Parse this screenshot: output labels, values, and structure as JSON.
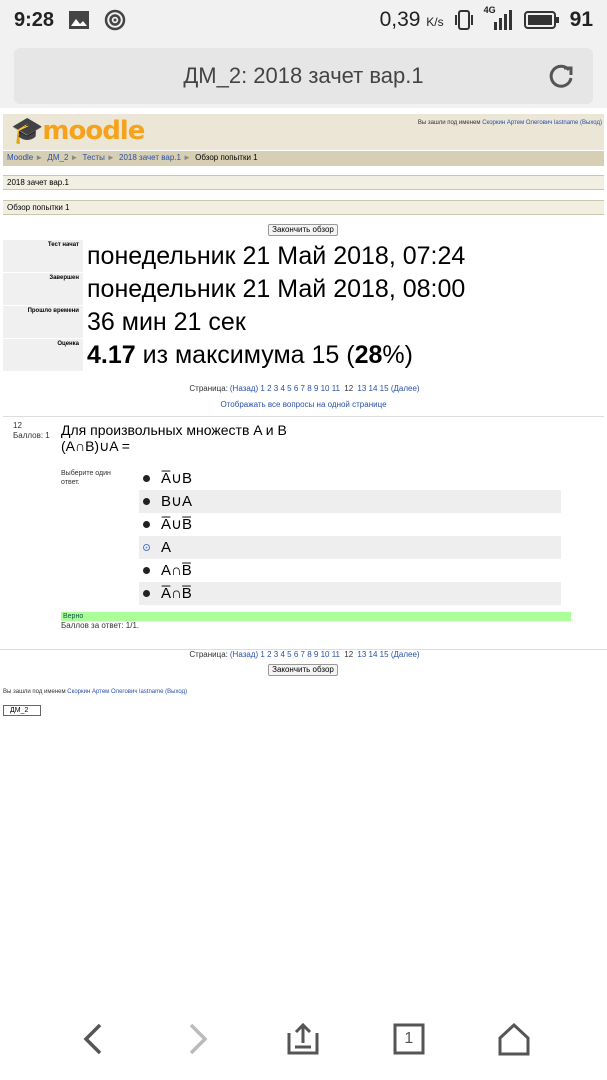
{
  "status": {
    "time": "9:28",
    "speed": "0,39",
    "speed_unit": "K/s",
    "network": "4G",
    "battery": "91"
  },
  "browser": {
    "title": "ДМ_2: 2018 зачет вар.1",
    "tabs_count": "1"
  },
  "header": {
    "logo": "moodle",
    "login_prefix": "Вы зашли под именем",
    "user": "Скоркин Артем Олегович lastname",
    "logout": "(Выход)"
  },
  "breadcrumb": [
    "Moodle",
    "ДМ_2",
    "Тесты",
    "2018 зачет вар.1",
    "Обзор попытки 1"
  ],
  "quiz_title": "2018 зачет вар.1",
  "review_title": "Обзор попытки 1",
  "finish_button": "Закончить обзор",
  "summary": [
    {
      "label": "Тест начат",
      "value": "понедельник 21 Май 2018, 07:24"
    },
    {
      "label": "Завершен",
      "value": "понедельник 21 Май 2018, 08:00"
    },
    {
      "label": "Прошло времени",
      "value": "36 мин 21 сек"
    },
    {
      "label": "Оценка",
      "value_score": "4.17",
      "value_mid": " из максимума 15 (",
      "value_pct": "28",
      "value_end": "%)"
    }
  ],
  "pager": {
    "label": "Страница:",
    "prev": "(Назад)",
    "pages": [
      "1",
      "2",
      "3",
      "4",
      "5",
      "6",
      "7",
      "8",
      "9",
      "10",
      "11",
      "12",
      "13",
      "14",
      "15"
    ],
    "current": "12",
    "next": "(Далее)",
    "show_all": "Отображать все вопросы на одной странице"
  },
  "question": {
    "number": "12",
    "points": "Баллов: 1",
    "text_line1": "Для произвольных множеств A и B",
    "text_line2": "(A∩B)∪A =",
    "prompt": "Выберите один ответ.",
    "answers": [
      "A̅∪B",
      "B∪A",
      "A̅∪B̅",
      "A",
      "A∩B̅",
      "A̅∩B̅"
    ],
    "selected_index": 3,
    "feedback": "Верно",
    "score_text": "Баллов за ответ: 1/1."
  },
  "footer": {
    "course_button": "ДМ_2"
  }
}
